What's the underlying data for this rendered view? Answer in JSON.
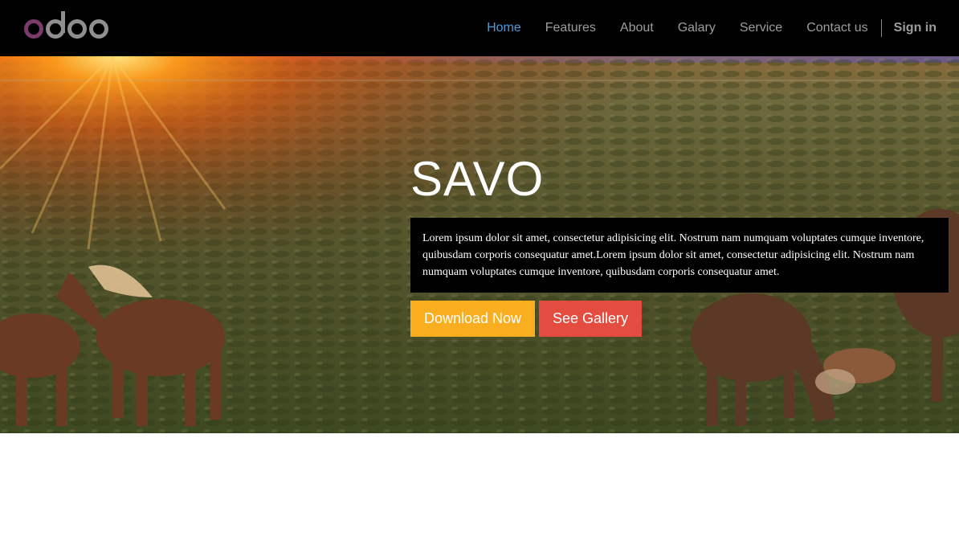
{
  "brand": {
    "logo_text": "odoo",
    "colors": {
      "o1": "#7b3a6c",
      "rest": "#8f8f8f",
      "nav_bg": "#000000",
      "active": "#4a9bd8"
    }
  },
  "nav": {
    "items": [
      {
        "label": "Home",
        "active": true
      },
      {
        "label": "Features",
        "active": false
      },
      {
        "label": "About",
        "active": false
      },
      {
        "label": "Galary",
        "active": false
      },
      {
        "label": "Service",
        "active": false
      },
      {
        "label": "Contact us",
        "active": false
      }
    ],
    "sign_in": "Sign in"
  },
  "hero": {
    "title": "SAVO",
    "text": "Lorem ipsum dolor sit amet, consectetur adipisicing elit. Nostrum nam numquam voluptates cumque inventore, quibusdam corporis consequatur amet.Lorem ipsum dolor sit amet, consectetur adipisicing elit. Nostrum nam numquam voluptates cumque inventore, quibusdam corporis consequatur amet.",
    "download_label": "Download Now",
    "gallery_label": "See Gallery",
    "download_color": "#f9ae20",
    "gallery_color": "#e34c3f",
    "background_image": "sunset-field-horses"
  }
}
